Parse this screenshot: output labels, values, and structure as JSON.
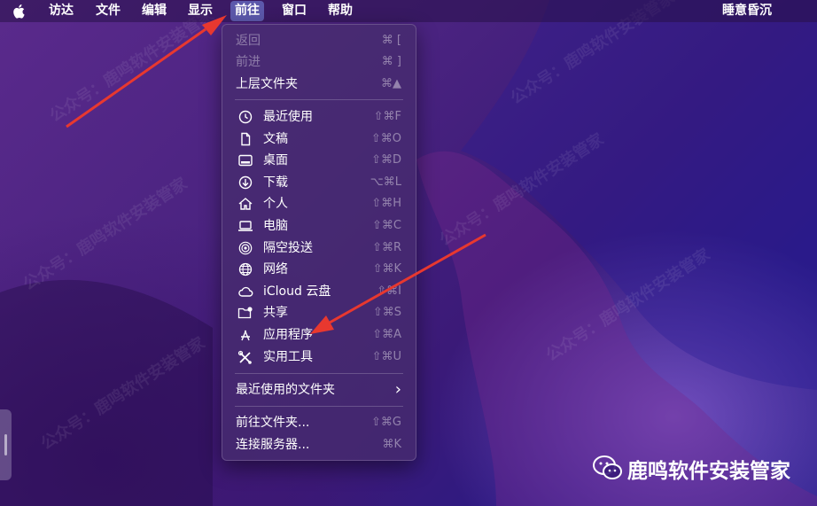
{
  "menubar": {
    "app_name": "访达",
    "items": [
      "文件",
      "编辑",
      "显示",
      "前往",
      "窗口",
      "帮助"
    ],
    "active_item": "前往",
    "clock": "睡意昏沉"
  },
  "go_menu": {
    "items": [
      {
        "label": "返回",
        "shortcut": "⌘ [",
        "disabled": true
      },
      {
        "label": "前进",
        "shortcut": "⌘ ]",
        "disabled": true
      },
      {
        "label": "上层文件夹",
        "shortcut": "⌘▲"
      },
      {
        "label": "最近使用",
        "shortcut": "⇧⌘F",
        "icon": "clock-icon"
      },
      {
        "label": "文稿",
        "shortcut": "⇧⌘O",
        "icon": "document-icon"
      },
      {
        "label": "桌面",
        "shortcut": "⇧⌘D",
        "icon": "desktop-icon"
      },
      {
        "label": "下载",
        "shortcut": "⌥⌘L",
        "icon": "download-icon"
      },
      {
        "label": "个人",
        "shortcut": "⇧⌘H",
        "icon": "home-icon"
      },
      {
        "label": "电脑",
        "shortcut": "⇧⌘C",
        "icon": "laptop-icon"
      },
      {
        "label": "隔空投送",
        "shortcut": "⇧⌘R",
        "icon": "airdrop-icon"
      },
      {
        "label": "网络",
        "shortcut": "⇧⌘K",
        "icon": "network-icon"
      },
      {
        "label": "iCloud 云盘",
        "shortcut": "⇧⌘I",
        "icon": "cloud-icon"
      },
      {
        "label": "共享",
        "shortcut": "⇧⌘S",
        "icon": "shared-folder-icon"
      },
      {
        "label": "应用程序",
        "shortcut": "⇧⌘A",
        "icon": "applications-icon"
      },
      {
        "label": "实用工具",
        "shortcut": "⇧⌘U",
        "icon": "utilities-icon"
      },
      {
        "label": "最近使用的文件夹",
        "submenu_indicator": "›"
      },
      {
        "label": "前往文件夹...",
        "shortcut": "⇧⌘G"
      },
      {
        "label": "连接服务器...",
        "shortcut": "⌘K"
      }
    ]
  },
  "watermark": {
    "text": "公众号：鹿鸣软件安装管家",
    "badge_text": "鹿鸣软件安装管家",
    "badge_icon": "wechat-icon"
  },
  "colors": {
    "annotation_arrow": "#e8382f",
    "menu_highlight": "#7f8ce6"
  }
}
